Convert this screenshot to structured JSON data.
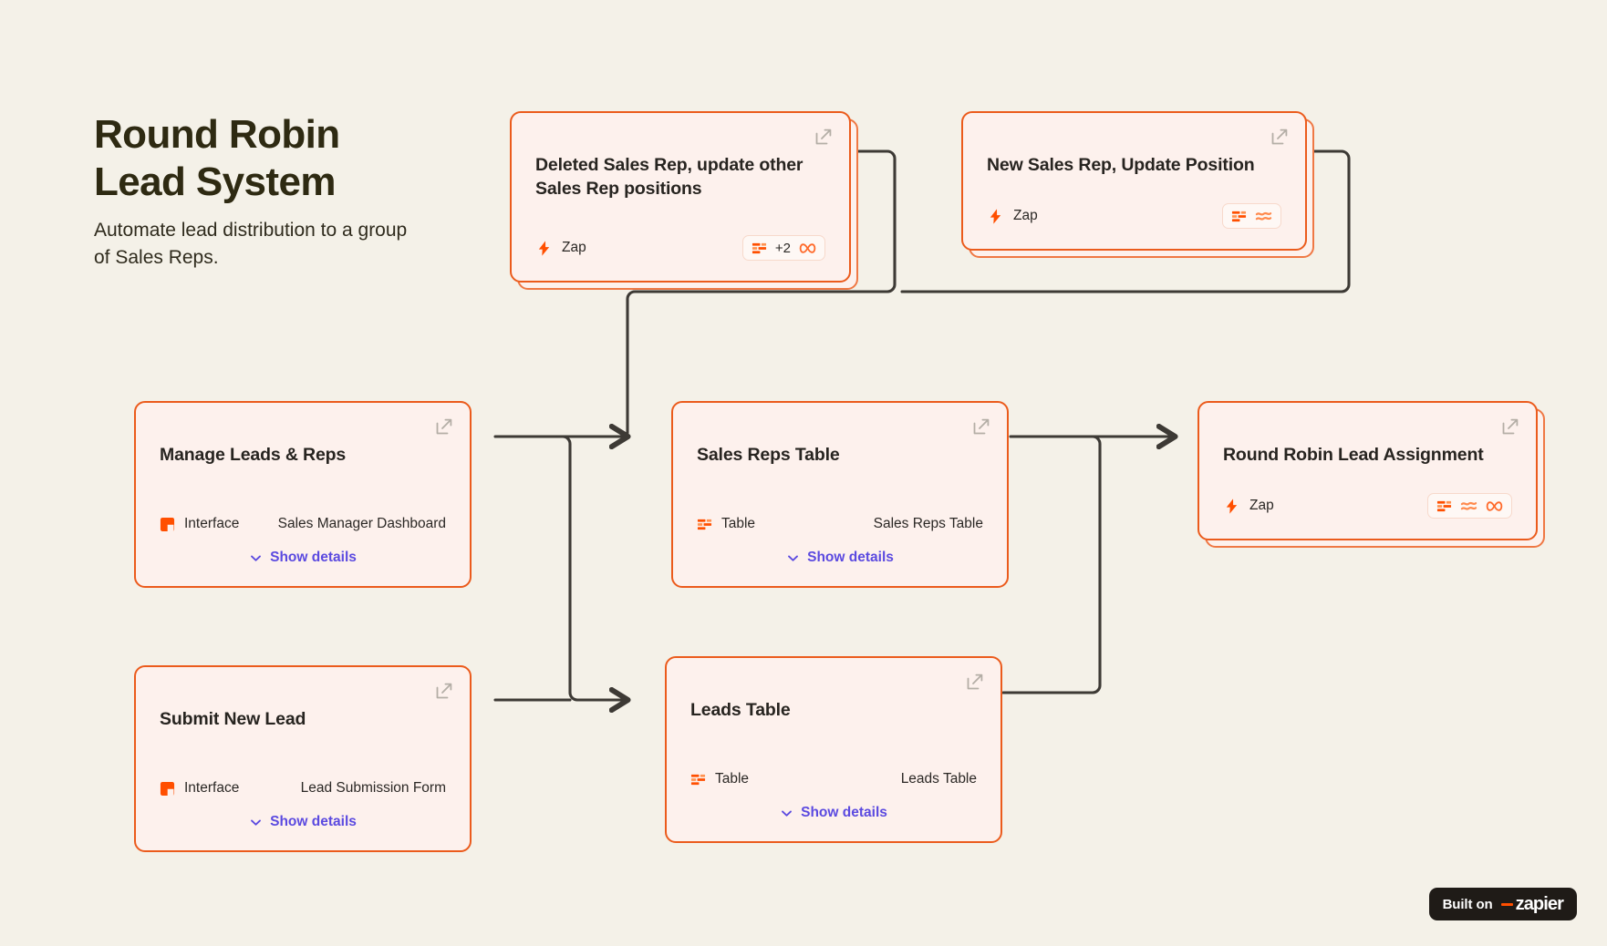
{
  "header": {
    "title": "Round Robin\nLead System",
    "subtitle": "Automate lead distribution to a group\nof Sales Reps."
  },
  "colors": {
    "background": "#f4f1e8",
    "card_fill": "#fdf1ed",
    "card_border": "#eb5b1c",
    "accent_orange": "#ff4f00",
    "link_purple": "#5b4ae0",
    "connector": "#3d3a35",
    "title_text": "#2e2a12"
  },
  "labels": {
    "show_details": "Show details",
    "external_link_icon": "external-link-icon",
    "chevron_down_icon": "chevron-down-icon"
  },
  "cards": [
    {
      "id": "deleted-sales-rep",
      "title": "Deleted Sales Rep, update other\nSales Rep positions",
      "type": "Zap",
      "type_icon": "zap-bolt-icon",
      "badge": {
        "icons": [
          "table-icon",
          "loop-icon"
        ],
        "count": "+2"
      },
      "stacked": true,
      "has_details": false
    },
    {
      "id": "new-sales-rep",
      "title": "New Sales Rep, Update Position",
      "type": "Zap",
      "type_icon": "zap-bolt-icon",
      "badge": {
        "icons": [
          "table-icon",
          "filter-icon"
        ],
        "count": ""
      },
      "stacked": true,
      "has_details": false
    },
    {
      "id": "manage-leads-reps",
      "title": "Manage Leads & Reps",
      "type": "Interface",
      "type_icon": "interface-icon",
      "value": "Sales Manager Dashboard",
      "stacked": false,
      "has_details": true
    },
    {
      "id": "sales-reps-table",
      "title": "Sales Reps Table",
      "type": "Table",
      "type_icon": "table-icon",
      "value": "Sales Reps Table",
      "stacked": false,
      "has_details": true
    },
    {
      "id": "round-robin-lead-assignment",
      "title": "Round Robin Lead Assignment",
      "type": "Zap",
      "type_icon": "zap-bolt-icon",
      "badge": {
        "icons": [
          "table-icon",
          "filter-icon",
          "loop-icon"
        ],
        "count": ""
      },
      "stacked": true,
      "has_details": false
    },
    {
      "id": "submit-new-lead",
      "title": "Submit New Lead",
      "type": "Interface",
      "type_icon": "interface-icon",
      "value": "Lead Submission Form",
      "stacked": false,
      "has_details": true
    },
    {
      "id": "leads-table",
      "title": "Leads Table",
      "type": "Table",
      "type_icon": "table-icon",
      "value": "Leads Table",
      "stacked": false,
      "has_details": true
    }
  ],
  "footer": {
    "built_on": "Built on",
    "brand": "zapier"
  }
}
